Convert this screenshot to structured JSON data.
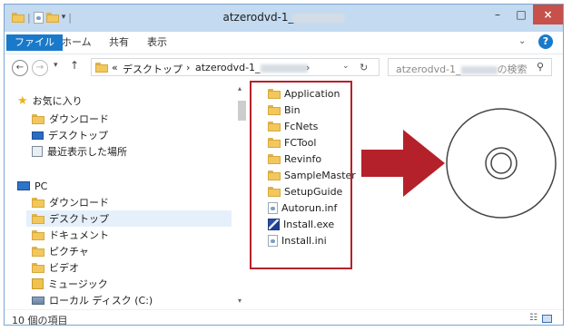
{
  "window": {
    "title": "atzerodvd-1_",
    "controls": {
      "minimize": "–",
      "maximize": "□",
      "close": "×"
    }
  },
  "ribbon": {
    "tabs": [
      "ファイル",
      "ホーム",
      "共有",
      "表示"
    ],
    "help": "?"
  },
  "address": {
    "back": "←",
    "forward": "→",
    "up": "↑",
    "crumbs": [
      "«",
      "デスクトップ",
      "›",
      "atzerodvd-1_"
    ],
    "search_placeholder": "atzerodvd-1_",
    "search_suffix": "の検索"
  },
  "nav": {
    "favorites": "お気に入り",
    "fav_items": [
      "ダウンロード",
      "デスクトップ",
      "最近表示した場所"
    ],
    "pc": "PC",
    "pc_items": [
      "ダウンロード",
      "デスクトップ",
      "ドキュメント",
      "ピクチャ",
      "ビデオ",
      "ミュージック",
      "ローカル ディスク (C:)"
    ]
  },
  "files": [
    {
      "name": "Application",
      "icon": "folder-icon"
    },
    {
      "name": "Bin",
      "icon": "folder-icon"
    },
    {
      "name": "FcNets",
      "icon": "folder-icon"
    },
    {
      "name": "FCTool",
      "icon": "folder-icon"
    },
    {
      "name": "Revinfo",
      "icon": "folder-icon"
    },
    {
      "name": "SampleMaster",
      "icon": "folder-icon"
    },
    {
      "name": "SetupGuide",
      "icon": "folder-icon"
    },
    {
      "name": "Autorun.inf",
      "icon": "settings-file-icon"
    },
    {
      "name": "Install.exe",
      "icon": "installer-icon"
    },
    {
      "name": "Install.ini",
      "icon": "settings-file-icon"
    }
  ],
  "status": {
    "item_count": "10 個の項目"
  },
  "colors": {
    "highlight_box": "#b5212a",
    "arrow": "#b5212a",
    "accent": "#1979ca"
  }
}
